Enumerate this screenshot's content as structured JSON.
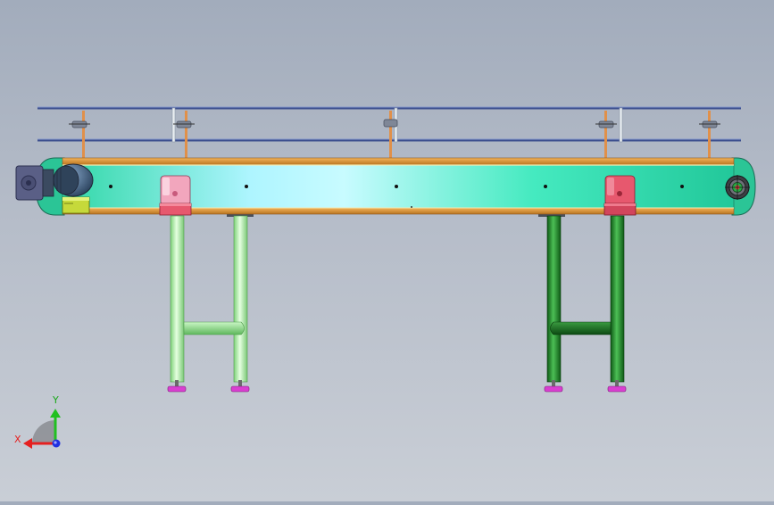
{
  "viewport": {
    "background_top": "#a2acbc",
    "background_bottom": "#c9ced6"
  },
  "model": {
    "frame_color": "#33e8b8",
    "belt_edge_color": "#e09a3a",
    "guardrail_color": "#3c4f8e",
    "bracket_post_color": "#e0904a",
    "left_leg_color": "#a6eea0",
    "right_leg_color": "#1e8a2a",
    "mount_block_color": "#e7586e",
    "foot_color": "#d93fd0",
    "motor_color": "#3f5a7a",
    "gearbox_color": "#6a6f8a",
    "idler_color": "#2aa845"
  },
  "triad": {
    "x_label": "X",
    "y_label": "Y",
    "x_color": "#e52020",
    "y_color": "#20c020",
    "z_color": "#2030e0"
  }
}
